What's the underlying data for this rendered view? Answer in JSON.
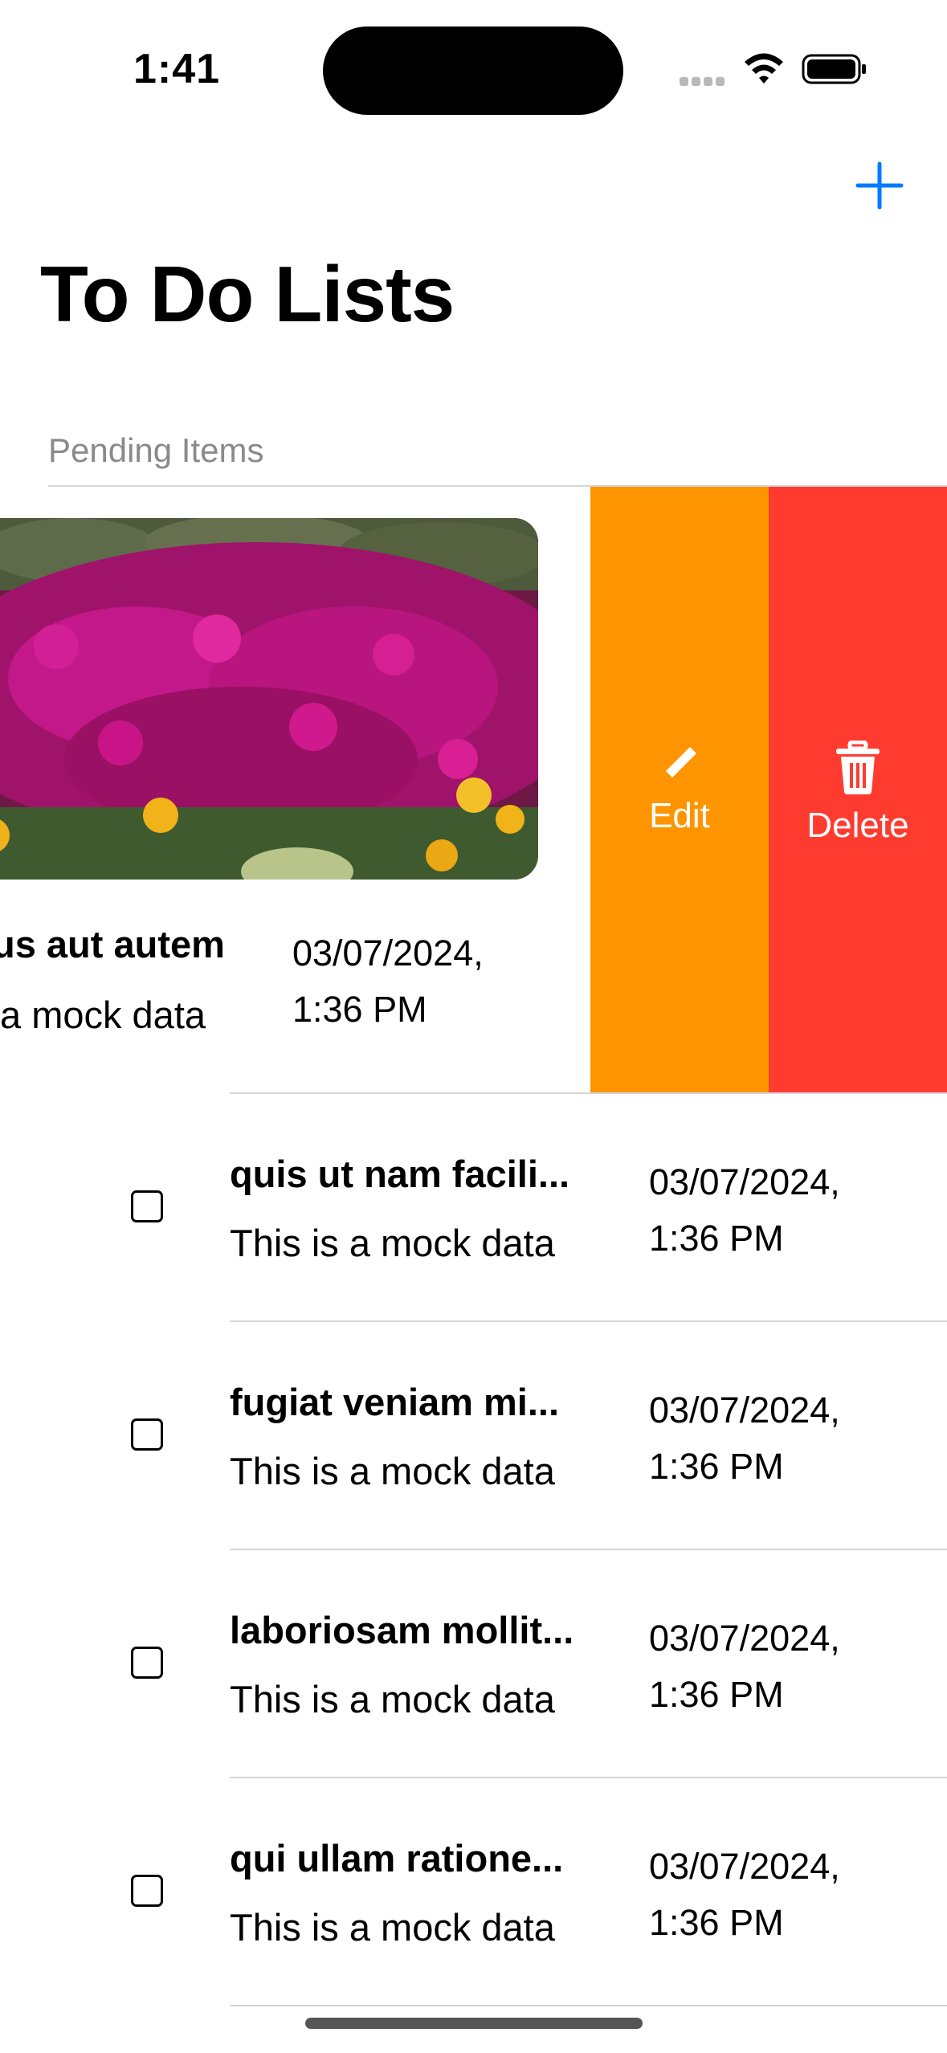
{
  "status_bar": {
    "time": "1:41"
  },
  "nav": {
    "add_icon": "plus-icon",
    "title": "To Do Lists"
  },
  "section": {
    "header": "Pending Items"
  },
  "swiped_row": {
    "title": "us aut autem",
    "subtitle": "a mock data",
    "date_line1": "03/07/2024,",
    "date_line2": "1:36 PM",
    "actions": [
      {
        "label": "Edit",
        "icon": "pencil-icon",
        "color": "#fe9500"
      },
      {
        "label": "Delete",
        "icon": "trash-icon",
        "color": "#ff3b30"
      }
    ]
  },
  "items": [
    {
      "title": "quis ut nam facili...",
      "subtitle": "This is a mock data",
      "date_line1": "03/07/2024,",
      "date_line2": "1:36 PM",
      "checked": false
    },
    {
      "title": "fugiat veniam mi...",
      "subtitle": "This is a mock data",
      "date_line1": "03/07/2024,",
      "date_line2": "1:36 PM",
      "checked": false
    },
    {
      "title": "laboriosam mollit...",
      "subtitle": "This is a mock data",
      "date_line1": "03/07/2024,",
      "date_line2": "1:36 PM",
      "checked": false
    },
    {
      "title": "qui ullam ratione...",
      "subtitle": "This is a mock data",
      "date_line1": "03/07/2024,",
      "date_line2": "1:36 PM",
      "checked": false
    }
  ],
  "colors": {
    "accent": "#007aff",
    "edit": "#fe9500",
    "delete": "#ff3b30"
  }
}
